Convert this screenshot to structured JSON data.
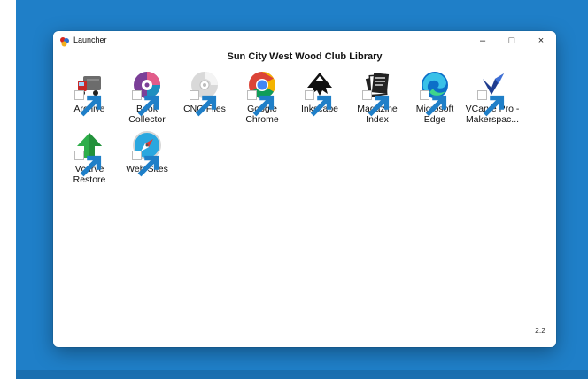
{
  "window": {
    "title": "Launcher",
    "controls": {
      "minimize": "–",
      "maximize": "□",
      "close": "×"
    }
  },
  "heading": "Sun City West Wood Club Library",
  "shortcuts": [
    {
      "label": "Archive",
      "icon": "archive-truck-icon"
    },
    {
      "label": "Book Collector",
      "icon": "book-collector-icon"
    },
    {
      "label": "CNC Files",
      "icon": "cd-disc-icon"
    },
    {
      "label": "Google Chrome",
      "icon": "chrome-icon"
    },
    {
      "label": "Inkscape",
      "icon": "inkscape-icon"
    },
    {
      "label": "Magazine Index",
      "icon": "magazine-icon"
    },
    {
      "label": "Microsoft Edge",
      "icon": "edge-icon"
    },
    {
      "label": "VCarve Pro - Makerspac...",
      "icon": "vcarve-icon"
    },
    {
      "label": "Vcarve Restore",
      "icon": "green-arrow-icon"
    },
    {
      "label": "Web Sites",
      "icon": "safari-compass-icon"
    }
  ],
  "version": "2.2",
  "colors": {
    "desktop": "#1f7fc8",
    "window": "#ffffff"
  }
}
